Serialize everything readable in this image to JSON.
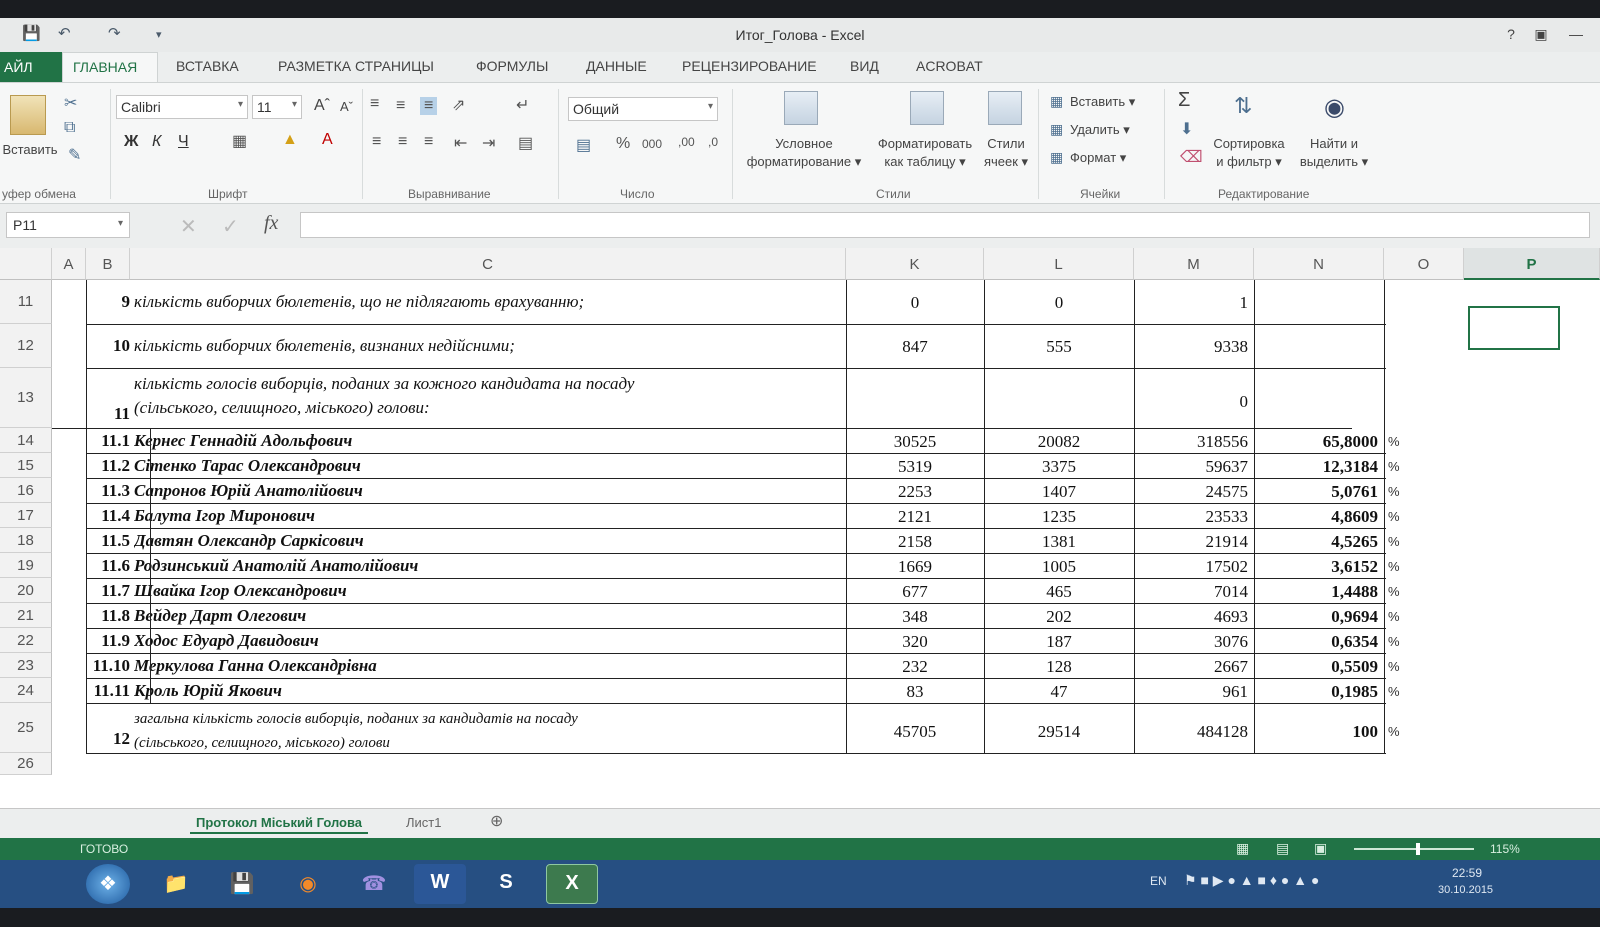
{
  "window": {
    "title": "Итог_Голова - Excel"
  },
  "tabs": {
    "file": "АЙЛ",
    "home": "ГЛАВНАЯ",
    "others": [
      "ВСТАВКА",
      "РАЗМЕТКА СТРАНИЦЫ",
      "ФОРМУЛЫ",
      "ДАННЫЕ",
      "РЕЦЕНЗИРОВАНИЕ",
      "ВИД",
      "ACROBAT"
    ]
  },
  "ribbon": {
    "paste": "Вставить",
    "clipboard": "уфер обмена",
    "font_name": "Calibri",
    "font_size": "11",
    "font_group": "Шрифт",
    "bold": "Ж",
    "italic": "К",
    "underline": "Ч",
    "align_group": "Выравнивание",
    "number_format": "Общий",
    "number_group": "Число",
    "cond_format": "Условное",
    "cond_format2": "форматирование",
    "format_table": "Форматировать",
    "format_table2": "как таблицу",
    "cell_styles": "Стили",
    "cell_styles2": "ячеек",
    "styles_group": "Стили",
    "insert": "Вставить",
    "delete": "Удалить",
    "format": "Формат",
    "cells_group": "Ячейки",
    "sort": "Сортировка",
    "sort2": "и фильтр",
    "find": "Найти и",
    "find2": "выделить",
    "edit_group": "Редактирование"
  },
  "formula_bar": {
    "name_box": "P11",
    "fx": "fx"
  },
  "columns": [
    "A",
    "B",
    "C",
    "K",
    "L",
    "M",
    "N",
    "O",
    "P"
  ],
  "rows": [
    {
      "row": "11",
      "num": "9",
      "text": "кількість виборчих бюлетенів, що не підлягають врахуванню;",
      "k": "0",
      "l": "0",
      "m": "1",
      "n": "",
      "pct": ""
    },
    {
      "row": "12",
      "num": "10",
      "text": "кількість виборчих бюлетенів, визнаних недійсними;",
      "k": "847",
      "l": "555",
      "m": "9338",
      "n": "",
      "pct": ""
    },
    {
      "row": "13",
      "num": "11",
      "text": "кількість голосів виборців, поданих за кожного кандидата на посаду",
      "text2": "(сільського, селищного, міського) голови:",
      "k": "",
      "l": "",
      "m": "0",
      "n": "",
      "pct": ""
    },
    {
      "row": "14",
      "num": "11.1",
      "text": "Кернес Геннадій Адольфович",
      "k": "30525",
      "l": "20082",
      "m": "318556",
      "n": "65,8000",
      "pct": "%"
    },
    {
      "row": "15",
      "num": "11.2",
      "text": "Сітенко Тарас Олександрович",
      "k": "5319",
      "l": "3375",
      "m": "59637",
      "n": "12,3184",
      "pct": "%"
    },
    {
      "row": "16",
      "num": "11.3",
      "text": "Сапронов Юрій Анатолійович",
      "k": "2253",
      "l": "1407",
      "m": "24575",
      "n": "5,0761",
      "pct": "%"
    },
    {
      "row": "17",
      "num": "11.4",
      "text": "Балута Ігор Миронович",
      "k": "2121",
      "l": "1235",
      "m": "23533",
      "n": "4,8609",
      "pct": "%"
    },
    {
      "row": "18",
      "num": "11.5",
      "text": "Давтян Олександр Саркісович",
      "k": "2158",
      "l": "1381",
      "m": "21914",
      "n": "4,5265",
      "pct": "%"
    },
    {
      "row": "19",
      "num": "11.6",
      "text": "Родзинський Анатолій Анатолійович",
      "k": "1669",
      "l": "1005",
      "m": "17502",
      "n": "3,6152",
      "pct": "%"
    },
    {
      "row": "20",
      "num": "11.7",
      "text": "Швайка Ігор Олександрович",
      "k": "677",
      "l": "465",
      "m": "7014",
      "n": "1,4488",
      "pct": "%"
    },
    {
      "row": "21",
      "num": "11.8",
      "text": "Вейдер Дарт Олегович",
      "k": "348",
      "l": "202",
      "m": "4693",
      "n": "0,9694",
      "pct": "%"
    },
    {
      "row": "22",
      "num": "11.9",
      "text": "Ходос Едуард Давидович",
      "k": "320",
      "l": "187",
      "m": "3076",
      "n": "0,6354",
      "pct": "%"
    },
    {
      "row": "23",
      "num": "11.10",
      "text": "Меркулова Ганна Олександрівна",
      "k": "232",
      "l": "128",
      "m": "2667",
      "n": "0,5509",
      "pct": "%"
    },
    {
      "row": "24",
      "num": "11.11",
      "text": "Кроль Юрій Якович",
      "k": "83",
      "l": "47",
      "m": "961",
      "n": "0,1985",
      "pct": "%"
    },
    {
      "row": "25",
      "num": "12",
      "text": "загальна кількість голосів виборців, поданих за кандидатів на посаду",
      "text2": "(сільського, селищного, міського) голови",
      "k": "45705",
      "l": "29514",
      "m": "484128",
      "n": "100",
      "pct": "%"
    },
    {
      "row": "26",
      "num": "",
      "text": "",
      "k": "",
      "l": "",
      "m": "",
      "n": "",
      "pct": ""
    }
  ],
  "sheets": [
    "Протокол Міський Голова",
    "Лист1"
  ],
  "status": {
    "ready": "ГОТОВО",
    "zoom": "115%"
  },
  "taskbar": {
    "lang": "EN",
    "time": "22:59",
    "date": "30.10.2015"
  }
}
